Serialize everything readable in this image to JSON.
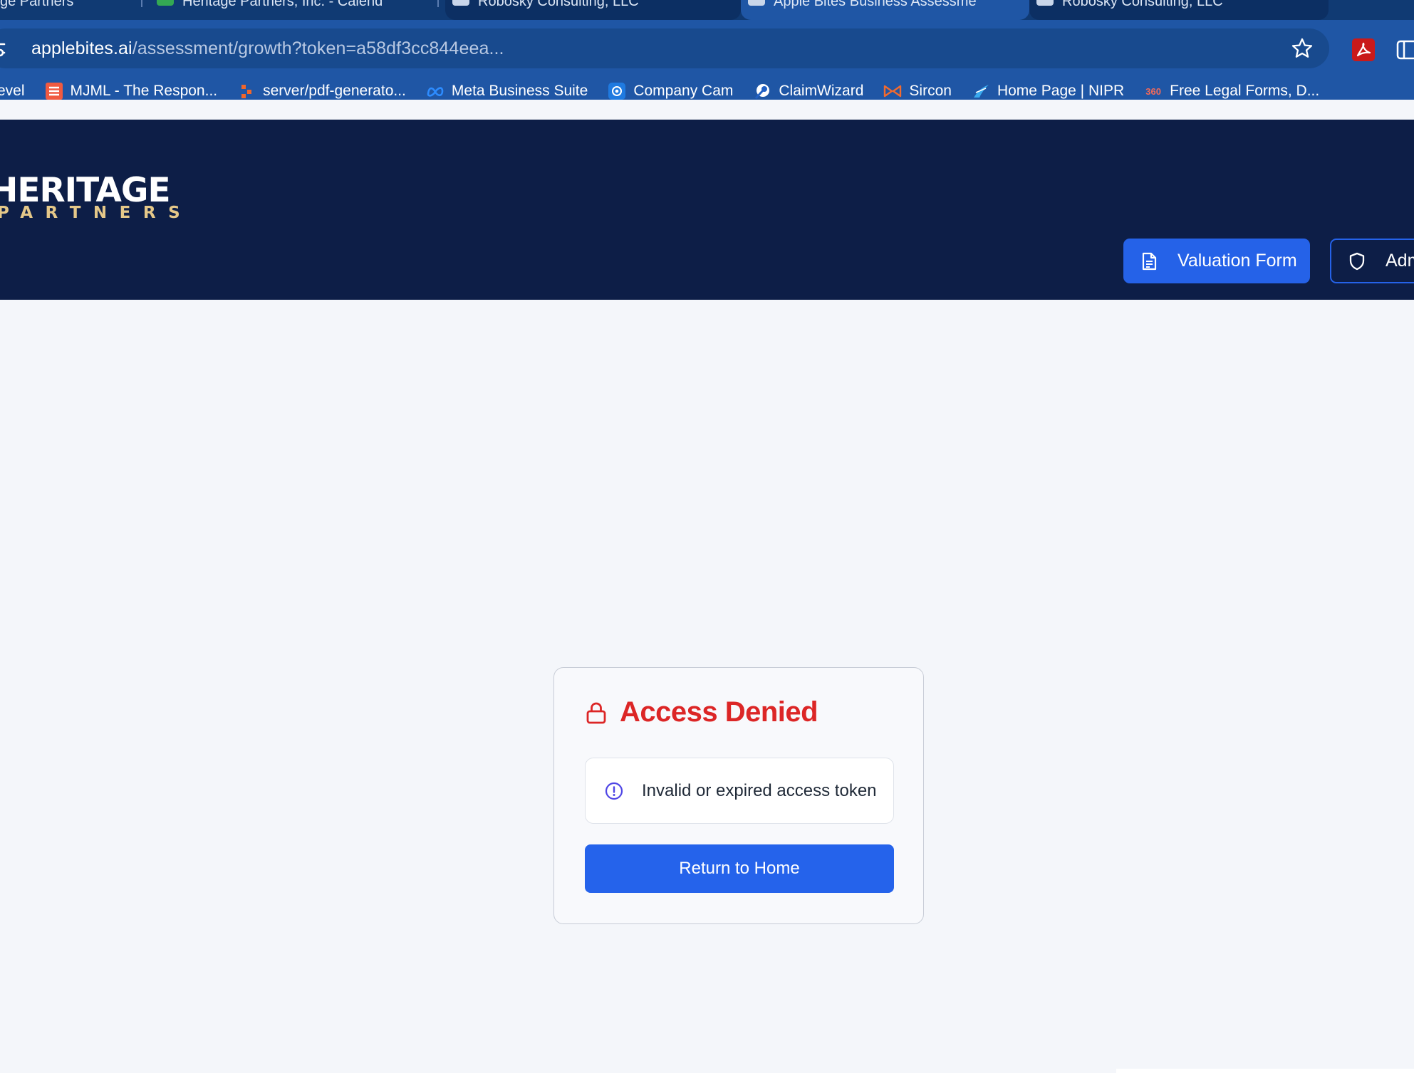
{
  "browser": {
    "tabs": [
      {
        "label": "ge Partners"
      },
      {
        "label": "Heritage Partners, Inc. - Calend"
      },
      {
        "label": "Robosky Consulting, LLC"
      },
      {
        "label": "Apple Bites Business Assessme"
      },
      {
        "label": "Robosky Consulting, LLC"
      }
    ],
    "url_host": "applebites.ai",
    "url_path": "/assessment/growth?token=a58df3cc844eea...",
    "bookmarks": [
      {
        "label": "evel",
        "icon": "none"
      },
      {
        "label": "MJML - The Respon...",
        "icon": "mjml-icon"
      },
      {
        "label": "server/pdf-generato...",
        "icon": "git-icon"
      },
      {
        "label": "Meta Business Suite",
        "icon": "meta-icon"
      },
      {
        "label": "Company Cam",
        "icon": "camera-icon"
      },
      {
        "label": "ClaimWizard",
        "icon": "wizard-icon"
      },
      {
        "label": "Sircon",
        "icon": "sircon-icon"
      },
      {
        "label": "Home Page | NIPR",
        "icon": "nipr-icon"
      },
      {
        "label": "Free Legal Forms, D...",
        "icon": "360-icon"
      }
    ],
    "bookmark_360_text": "360"
  },
  "header": {
    "logo_main": "HERITAGE",
    "logo_sub": "PARTNERS",
    "valuation_label": "Valuation Form",
    "admin_label": "Admin"
  },
  "card": {
    "title": "Access Denied",
    "alert_text": "Invalid or expired access token",
    "return_label": "Return to Home"
  },
  "colors": {
    "header_bg": "#0d1e47",
    "accent": "#2563eb",
    "error": "#dc2626",
    "logo_gold": "#e5c889"
  }
}
